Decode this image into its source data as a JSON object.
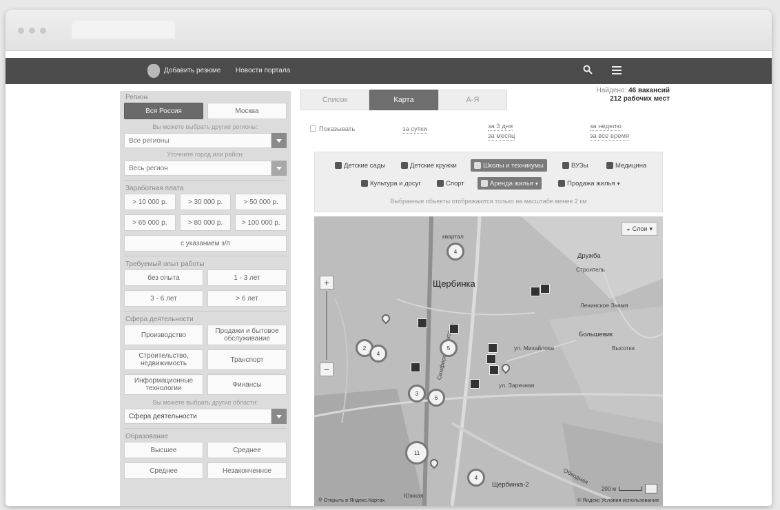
{
  "topbar": {
    "add_resume": "Добавить резюме",
    "news": "Новости портала"
  },
  "sidebar": {
    "region_label": "Регион",
    "region_all": "Вся Россия",
    "region_moscow": "Москва",
    "region_hint": "Вы можете выбрать другие регионы:",
    "regions_select": "Все регионы",
    "district_hint": "Уточните город или район:",
    "district_select": "Весь регион",
    "salary_label": "Заработная плата",
    "salary": [
      "> 10 000 р.",
      "> 30 000 р.",
      "> 50 000 р.",
      "> 65 000 р.",
      "> 80 000 р.",
      "> 100 000 р."
    ],
    "salary_specified": "с указанием з/п",
    "experience_label": "Требуемый опыт работы",
    "experience": [
      "без опыта",
      "1 - 3 лет",
      "3 - 6 лет",
      "> 6 лет"
    ],
    "sphere_label": "Сфера деятельности",
    "spheres": [
      "Производство",
      "Продажи и бытовое обслуживание",
      "Строительство, недвижимость",
      "Транспорт",
      "Информационные технологии",
      "Финансы"
    ],
    "sphere_hint": "Вы можете выбрать другие области:",
    "sphere_select": "Сфера деятельности",
    "education_label": "Образование",
    "education": [
      "Высшее",
      "Среднее",
      "Среднее",
      "Незаконченное"
    ]
  },
  "main": {
    "tabs": [
      "Список",
      "Карта",
      "А-Я"
    ],
    "found_prefix": "Найдено:",
    "found_vacancies": "46 вакансий",
    "found_places": "212 рабочих мест",
    "show_label": "Показывать",
    "periods": [
      "за сутки",
      "за 3 дня",
      "за месяц",
      "за неделю",
      "за все время"
    ],
    "categories": [
      {
        "label": "Детские сады",
        "icon": "rocket-icon"
      },
      {
        "label": "Детские кружки",
        "icon": "children-icon"
      },
      {
        "label": "Школы и техникумы",
        "icon": "school-icon"
      },
      {
        "label": "ВУЗы",
        "icon": "graduation-cap-icon"
      },
      {
        "label": "Медицина",
        "icon": "medical-icon"
      },
      {
        "label": "Культура и досуг",
        "icon": "museum-icon"
      },
      {
        "label": "Спорт",
        "icon": "ball-icon"
      },
      {
        "label": "Аренда жилья",
        "icon": "home-icon"
      },
      {
        "label": "Продажа жилья",
        "icon": "key-icon"
      }
    ],
    "note": "Выбранные объекты отображаются только на масштабе менее 2 км"
  },
  "map": {
    "layers": "Слои",
    "places": {
      "shcherbinka": "Щербинка",
      "shcherbinka2": "Щербинка-2",
      "druzhba": "Дружба",
      "stroitel": "Строитель",
      "bolshevik": "Большевик",
      "leninskoe": "Ленинское Знамя",
      "vysotki": "Высотки",
      "simf": "Симферопольское ш.",
      "obvodnaya": "Обводная",
      "zarechnaya": "ул. Заречная",
      "mikhail": "ул. Михайлова",
      "yuzhnaya": "Южная",
      "kvartal": "квартал"
    },
    "clusters": [
      "4",
      "2",
      "4",
      "5",
      "3",
      "6",
      "11",
      "4"
    ],
    "scale": "200 м",
    "copyright": "Открыть в Яндекс.Картах",
    "terms": "© Яндекс Условия использования"
  }
}
